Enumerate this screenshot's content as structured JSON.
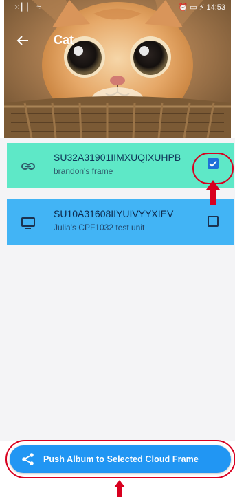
{
  "status_bar": {
    "left": "⁙▎▏ ≈",
    "right": "⏰ ▭ ⚡ 14:53"
  },
  "header": {
    "title": "Cat",
    "back_icon": "arrow-left-icon"
  },
  "frames": [
    {
      "id": "SU32A31901IIMXUQIXUHPB",
      "name": "brandon's frame",
      "icon": "link-icon",
      "selected": true,
      "color": "#5ee8c7"
    },
    {
      "id": "SU10A31608IIYUIVYYXIEV",
      "name": "Julia's CPF1032 test unit",
      "icon": "monitor-icon",
      "selected": false,
      "color": "#42b4f5"
    }
  ],
  "push_button": {
    "label": "Push Album to Selected Cloud Frame",
    "icon": "share-icon",
    "color": "#2196f3"
  },
  "annotation_color": "#d8001f"
}
